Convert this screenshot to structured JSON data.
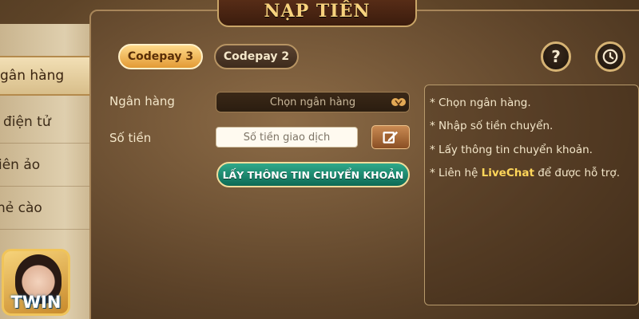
{
  "header": {
    "title": "NẠP TIỀN"
  },
  "sidebar": {
    "items": [
      {
        "label": "gân hàng"
      },
      {
        "label": " điện tử"
      },
      {
        "label": "iên ảo"
      },
      {
        "label": "hẻ cào"
      }
    ]
  },
  "logo": {
    "text": "TWIN"
  },
  "tabs": [
    {
      "label": "Codepay 3",
      "active": true
    },
    {
      "label": "Codepay 2",
      "active": false
    }
  ],
  "buttons": {
    "help": "?",
    "history_icon": "history-icon"
  },
  "form": {
    "bank_label": "Ngân hàng",
    "bank_select_value": "Chọn ngân hàng",
    "amount_label": "Số tiền",
    "amount_placeholder": "Số tiền giao dịch",
    "submit_label": "LẤY THÔNG TIN CHUYỂN KHOẢN"
  },
  "instructions": {
    "line1": "Chọn ngân hàng.",
    "line2": "Nhập số tiền chuyển.",
    "line3": "Lấy thông tin chuyển khoản.",
    "line4_prefix": "Liên hệ",
    "line4_highlight": "LiveChat",
    "line4_suffix": "để được hỗ trợ.",
    "bullet": "*"
  },
  "colors": {
    "accent_gold": "#f7d27d",
    "active_tab": "#e39a34",
    "submit_green": "#0d6a55",
    "livechat": "#ffd65a"
  }
}
